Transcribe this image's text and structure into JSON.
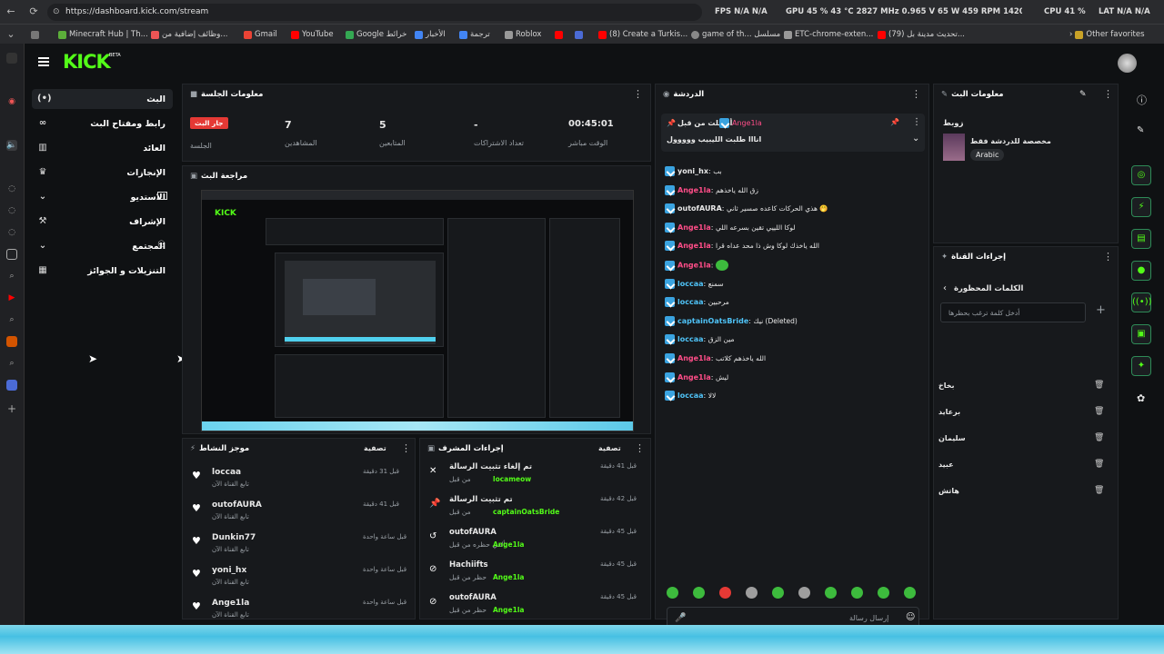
{
  "browser": {
    "url": "https://dashboard.kick.com/stream",
    "perf": [
      "FPS N/A N/A",
      "GPU 45 % 43 °C 2827 MHz 0.965 V 65 W 459 RPM 14201 MHz",
      "CPU 41 %",
      "LAT N/A N/A"
    ],
    "bookmarks": [
      "Minecraft Hub | Th...",
      "وظائف إضافية من...",
      "Gmail",
      "YouTube",
      "Google خرائط",
      "الأخبار",
      "ترجمة",
      "Roblox",
      "(8) Create a Turkis...",
      "game of th... مسلسل",
      "ETC-chrome-exten...",
      "(79) تحديث مدينة بل...",
      "Other favorites"
    ]
  },
  "app": {
    "logo": "KICK",
    "logo_sup": "BETA",
    "accent": "#53fc18"
  },
  "nav": {
    "items": [
      {
        "label": "البث",
        "icon": "live-icon"
      },
      {
        "label": "رابط ومفتاح البث",
        "icon": "link-icon"
      },
      {
        "label": "العائد",
        "icon": "chart-icon"
      },
      {
        "label": "الإنجازات",
        "icon": "trophy-icon"
      },
      {
        "label": "الاستديو",
        "icon": "studio-icon"
      },
      {
        "label": "الإشراف",
        "icon": "hammer-icon"
      },
      {
        "label": "المجتمع",
        "icon": "community-icon"
      },
      {
        "label": "التنزيلات و الجوائز",
        "icon": "gift-icon"
      }
    ]
  },
  "session": {
    "title": "معلومات الجلسة",
    "live_badge": "جار البث",
    "session_label": "الجلسة",
    "stats": [
      {
        "value": "7",
        "label": "المشاهدين"
      },
      {
        "value": "5",
        "label": "المتابعين"
      },
      {
        "value": "-",
        "label": "تعداد الاشتراكات"
      },
      {
        "value": "00:45:01",
        "label": "الوقت مباشر"
      }
    ]
  },
  "preview": {
    "title": "مراجعة البث"
  },
  "activity": {
    "title": "موجز النشاط",
    "filter": "تصفية",
    "items": [
      {
        "user": "loccaa",
        "action": "تابع القناة الآن",
        "time": "قبل 31 دقيقة"
      },
      {
        "user": "outofAURA",
        "action": "تابع القناة الآن",
        "time": "قبل 41 دقيقة"
      },
      {
        "user": "Dunkin77",
        "action": "تابع القناة الآن",
        "time": "قبل ساعة واحدة"
      },
      {
        "user": "yoni_hx",
        "action": "تابع القناة الآن",
        "time": "قبل ساعة واحدة"
      },
      {
        "user": "Ange1la",
        "action": "تابع القناة الآن",
        "time": "قبل ساعة واحدة"
      }
    ]
  },
  "modactions": {
    "title": "إجراءات المشرف",
    "filter": "تصفية",
    "items": [
      {
        "line1": "تم إلغاء تثبيت الرسالة",
        "by": "من قبل",
        "user": "locameow",
        "time": "قبل 41 دقيقة",
        "icon": "unpin-icon"
      },
      {
        "line1": "تم تثبيت الرسالة",
        "by": "من قبل",
        "user": "captainOatsBride",
        "time": "قبل 42 دقيقة",
        "icon": "pin-icon"
      },
      {
        "line1": "outofAURA",
        "by": "ألغي حظره من قبل",
        "user": "Ange1la",
        "time": "قبل 45 دقيقة",
        "icon": "undo-icon"
      },
      {
        "line1": "Hachiifts",
        "by": "حظر من قبل",
        "user": "Ange1la",
        "time": "قبل 45 دقيقة",
        "icon": "ban-icon"
      },
      {
        "line1": "outofAURA",
        "by": "حظر من قبل",
        "user": "Ange1la",
        "time": "قبل 45 دقيقة",
        "icon": "ban-icon"
      }
    ]
  },
  "chat": {
    "title": "الدردشة",
    "pinned_by_label": "أرسلت من قبل",
    "pinned_user": "Ange1la",
    "pinned_text": "انااا طلبت الليبيب ووووول",
    "messages": [
      {
        "user": "yoni_hx",
        "text": "بب",
        "color": "#e8e8e8"
      },
      {
        "user": "Ange1la",
        "text": "زق الله ياخذهم",
        "color": "#ff4d88"
      },
      {
        "user": "outofAURA",
        "text": "هذي الحركات كاعده صسير ثاني 🤭",
        "color": "#e8e8e8"
      },
      {
        "user": "Ange1la",
        "text": "لوكا اللييي تقين بسرعه اللي",
        "color": "#ff4d88"
      },
      {
        "user": "Ange1la",
        "text": "الله ياخذك لوكا وش ذا محد عداه قرا",
        "color": "#ff4d88"
      },
      {
        "user": "Ange1la",
        "text": "",
        "color": "#ff4d88"
      },
      {
        "user": "loccaa",
        "text": "سمنع",
        "color": "#4fc3f7"
      },
      {
        "user": "loccaa",
        "text": "مرحبين",
        "color": "#4fc3f7"
      },
      {
        "user": "captainOatsBride",
        "text": "نيك (Deleted)",
        "color": "#4fc3f7"
      },
      {
        "user": "loccaa",
        "text": "مين الزق",
        "color": "#4fc3f7"
      },
      {
        "user": "Ange1la",
        "text": "الله ياخذهم كلاتب",
        "color": "#ff4d88"
      },
      {
        "user": "Ange1la",
        "text": "ليش",
        "color": "#ff4d88"
      },
      {
        "user": "loccaa",
        "text": "لالا",
        "color": "#4fc3f7"
      }
    ],
    "input_placeholder": "إرسال رسالة",
    "send_label": "الدردشة"
  },
  "streaminfo": {
    "title": "معلومات البث",
    "stream_name": "زوبط",
    "category": "مخصصة للدردشة فقط",
    "language": "Arabic"
  },
  "channel_actions": {
    "title": "إجراءات القناة",
    "banned_words_title": "الكلمات المحظورة",
    "input_placeholder": "أدخل كلمة ترغب بحظرها",
    "words": [
      "بخاخ",
      "برعايد",
      "سليمان",
      "عبيد",
      "هاتش"
    ]
  }
}
